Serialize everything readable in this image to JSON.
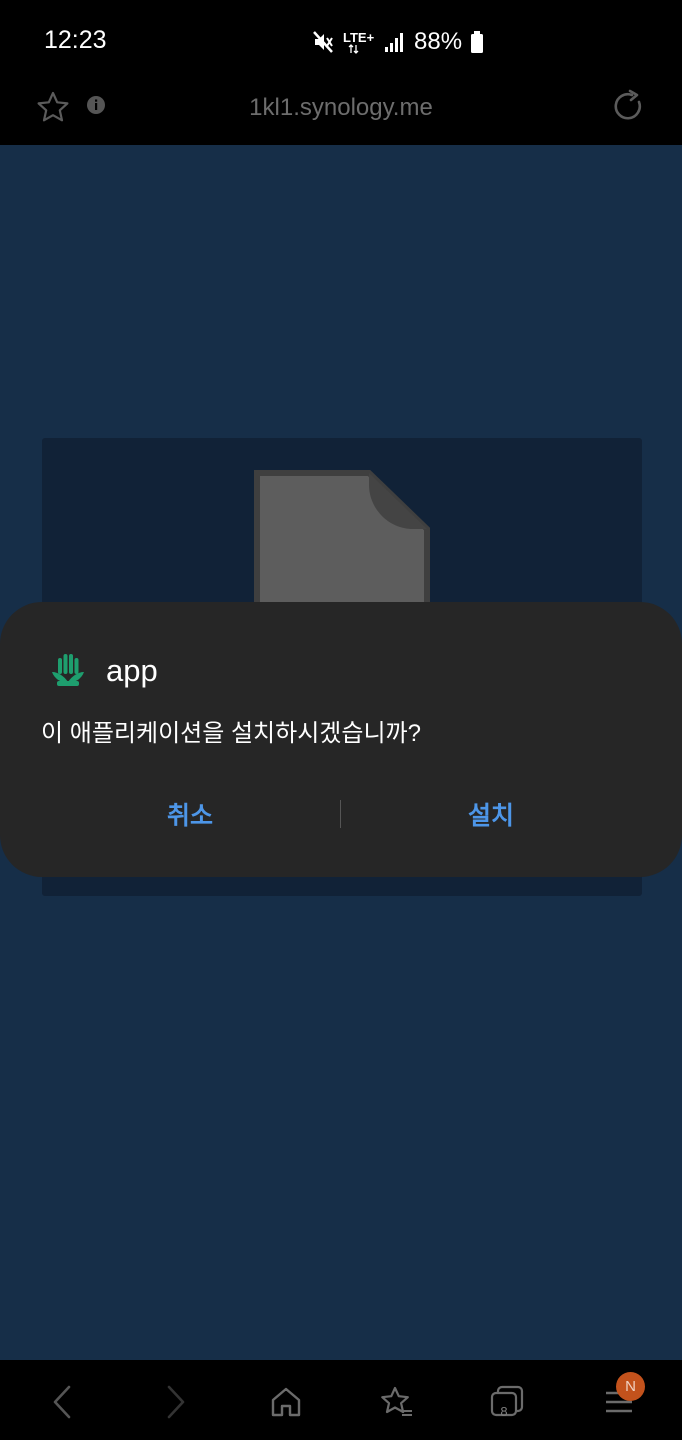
{
  "status_bar": {
    "time": "12:23",
    "network": "LTE+",
    "battery": "88%",
    "icons": [
      "mute-icon",
      "lte-icon",
      "signal-icon",
      "battery-icon"
    ]
  },
  "browser": {
    "url": "1kl1.synology.me",
    "icons": [
      "star-icon",
      "info-icon",
      "reload-icon"
    ]
  },
  "dialog": {
    "app_name": "app",
    "message": "이 애플리케이션을 설치하시겠습니까?",
    "cancel_label": "취소",
    "install_label": "설치",
    "accent": "#4d96e8",
    "app_icon": "hand-leaf-icon"
  },
  "bottom_bar": {
    "tab_count": "8",
    "badge": "N",
    "icons": [
      "back-icon",
      "forward-icon",
      "home-icon",
      "bookmarks-icon",
      "tabs-icon",
      "menu-icon"
    ]
  },
  "colors": {
    "page_bg": "#162e48",
    "dialog_bg": "#262626",
    "badge_bg": "#c3521c"
  }
}
